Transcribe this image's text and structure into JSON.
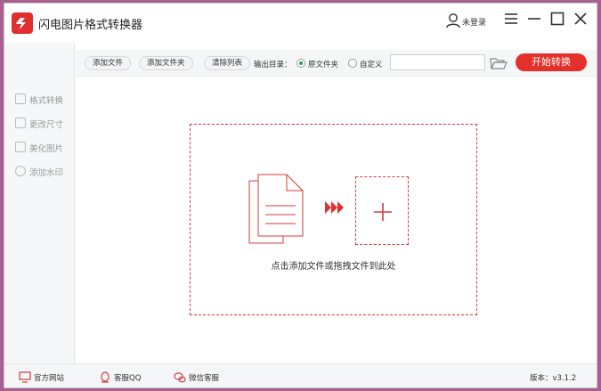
{
  "app": {
    "title": "闪电图片格式转换器",
    "brand_color": "#e12e2e",
    "logo_icon": "lightning-logo-icon"
  },
  "header": {
    "user_label": "未登录",
    "user_icon": "user-icon",
    "menu_icon": "hamburger-menu-icon",
    "minimize_icon": "minimize-icon",
    "maximize_icon": "maximize-icon",
    "close_icon": "close-icon"
  },
  "sidebar": {
    "items": [
      {
        "label": "格式转换",
        "icon": "format-convert-icon"
      },
      {
        "label": "更改尺寸",
        "icon": "resize-icon"
      },
      {
        "label": "美化图片",
        "icon": "beautify-icon"
      },
      {
        "label": "添加水印",
        "icon": "watermark-icon"
      }
    ]
  },
  "toolbar": {
    "add_file": "添加文件",
    "add_folder": "添加文件夹",
    "clear_list": "清除列表",
    "output_label": "输出目录：",
    "option_original": "原文件夹",
    "option_custom": "自定义",
    "selected_option": "原文件夹",
    "path_value": "",
    "start_label": "开始转换",
    "accent": "#e3302b"
  },
  "dropzone": {
    "hint": "点击添加文件或拖拽文件到此处",
    "icons": [
      "document-icon",
      "triple-arrow-icon",
      "plus-icon"
    ]
  },
  "statusbar": {
    "website": "官方网站",
    "qq": "客服QQ",
    "wechat": "微信客服",
    "version": "版本：v3.1.2"
  }
}
